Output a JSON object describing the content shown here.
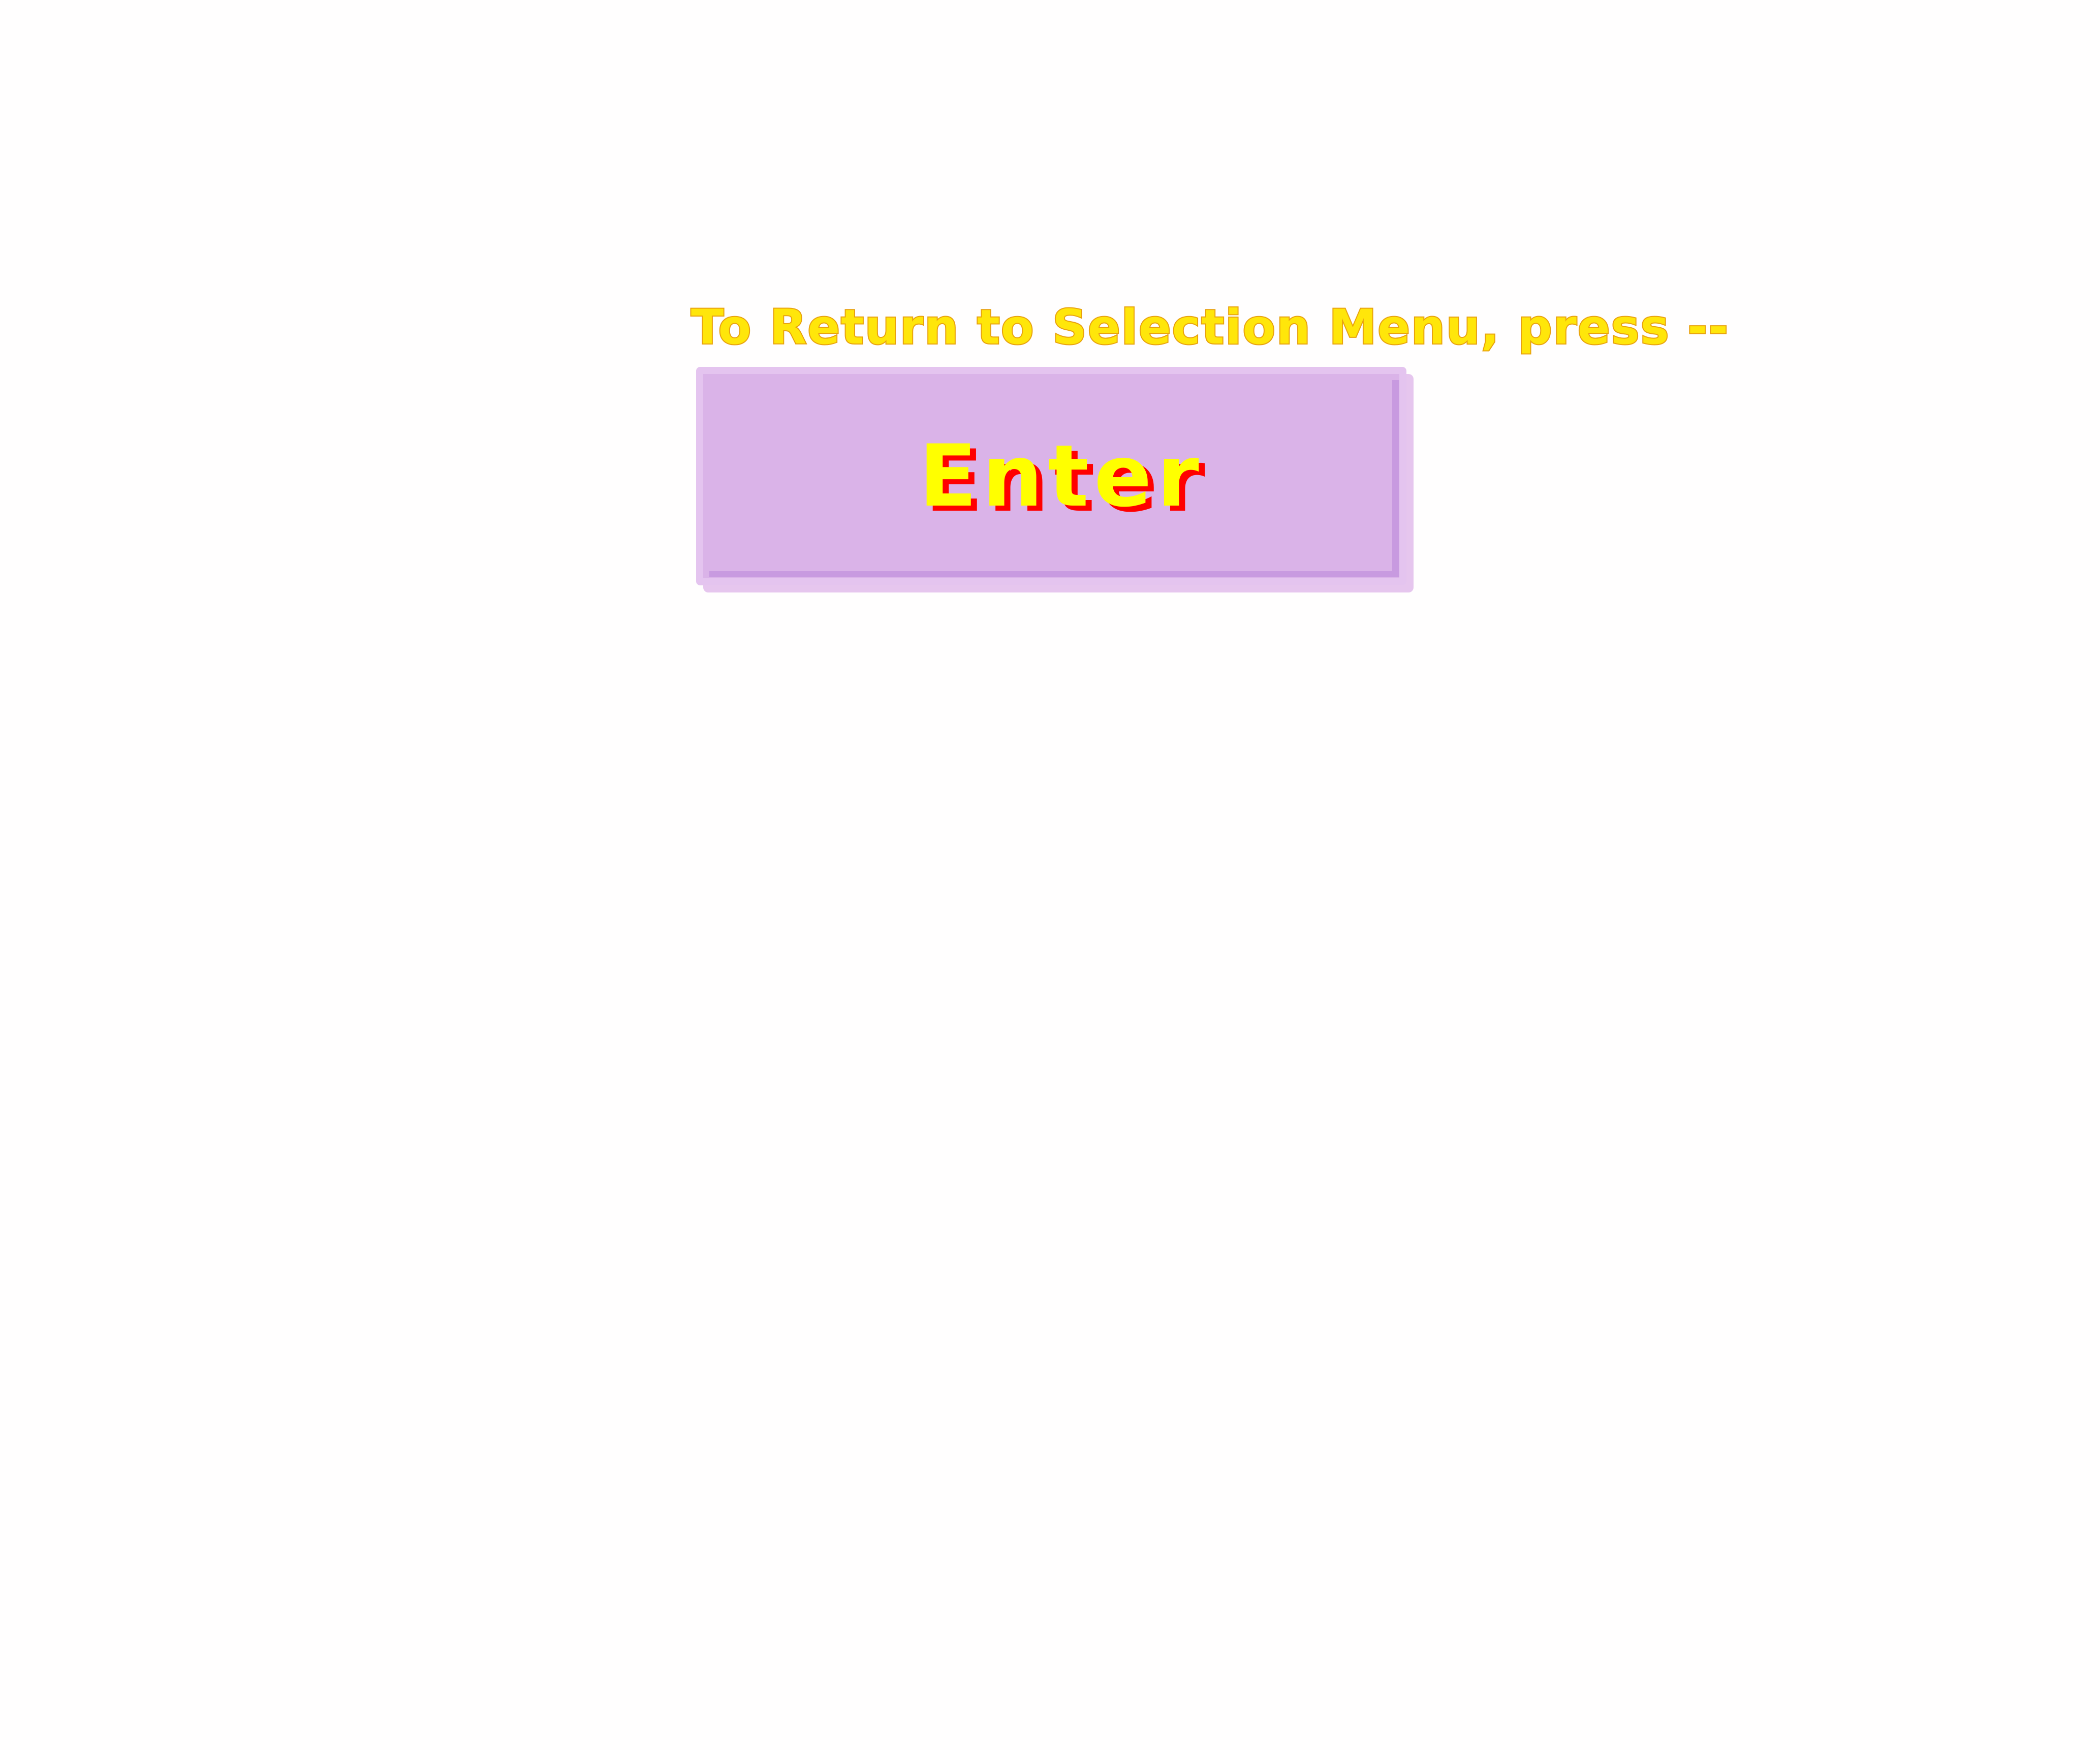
{
  "screen": {
    "instruction": "To Return to Selection Menu, press --",
    "enter_button_label": "Enter"
  },
  "colors": {
    "background": "#fffefe",
    "instruction_text": "#ffe60a",
    "instruction_outline": "#e8a10e",
    "button_face": "#dab3e8",
    "button_border": "#e4c4ef",
    "button_label_text": "#ffff00",
    "button_label_shadow": "#ff0000"
  }
}
